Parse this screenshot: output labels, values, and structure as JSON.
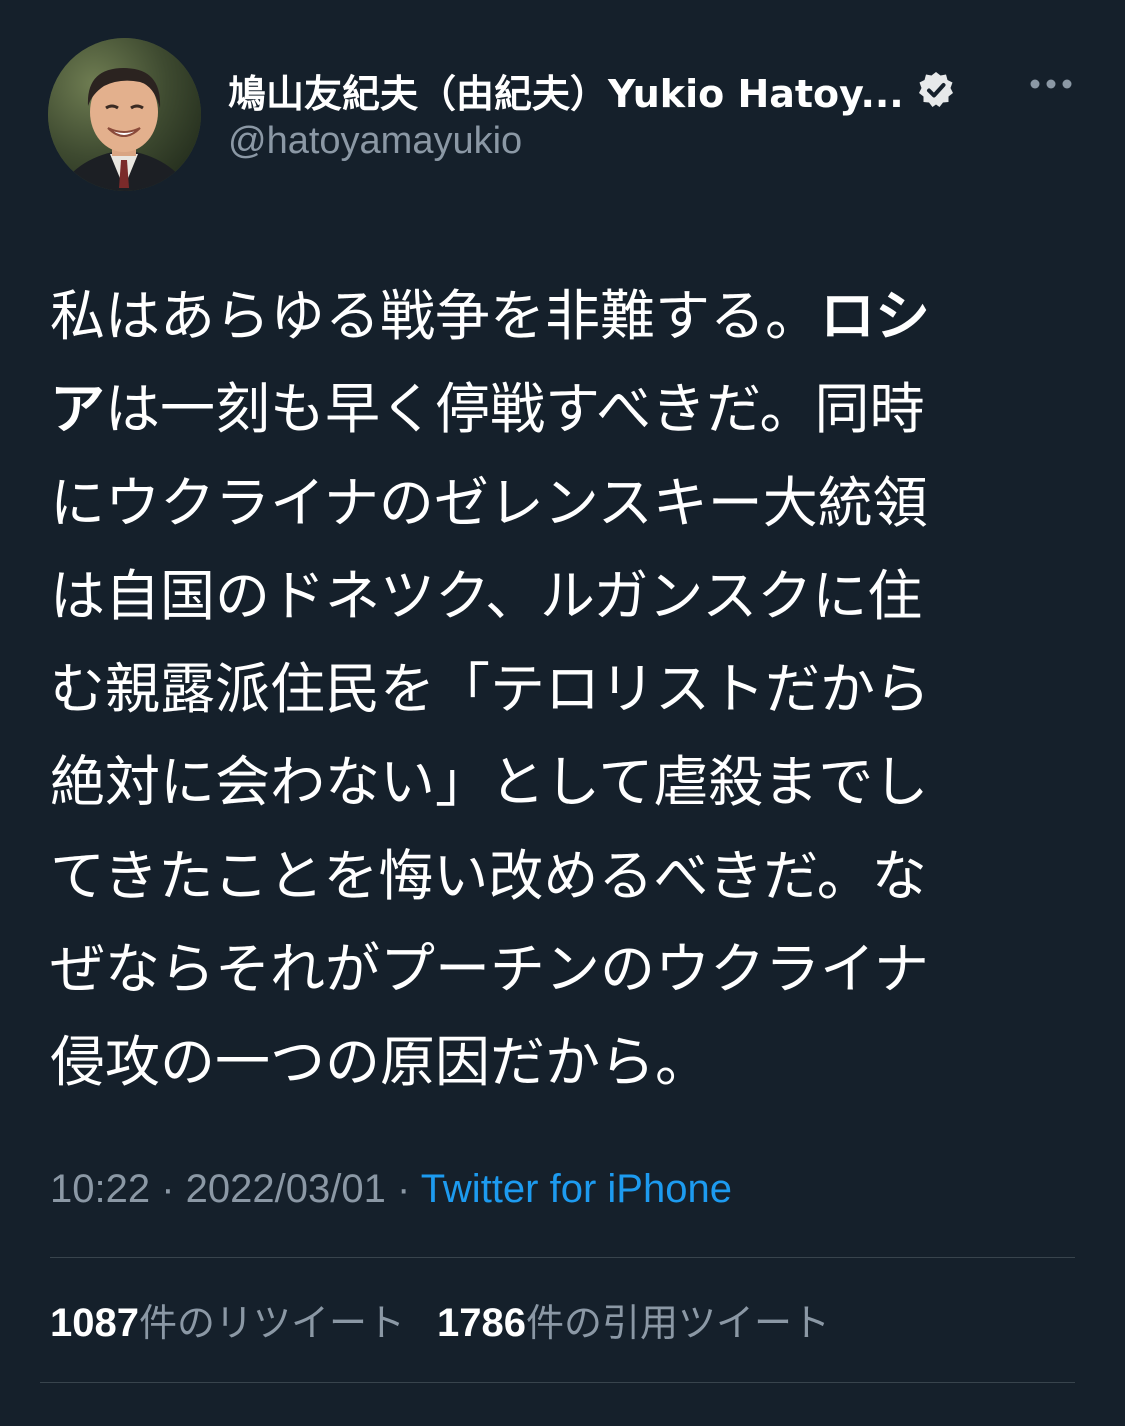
{
  "tweet": {
    "author": {
      "display_name": "鳩山友紀夫（由紀夫）Yukio Hatoy...",
      "handle": "@hatoyamayukio",
      "verified": true
    },
    "text_lines": [
      {
        "plain": "私はあらゆる戦争を非難する。",
        "bold": "ロシ"
      },
      {
        "bold": "ア",
        "plain": "は一刻も早く停戦すべきだ。同時"
      },
      {
        "plain": "にウクライナのゼレンスキー大統領"
      },
      {
        "plain": "は自国のドネツク、ルガンスクに住"
      },
      {
        "plain": "む親露派住民を「テロリストだから"
      },
      {
        "plain": "絶対に会わない」として虐殺までし"
      },
      {
        "plain": "てきたことを悔い改めるべきだ。な"
      },
      {
        "plain": "ぜならそれがプーチンのウクライナ"
      },
      {
        "plain": "侵攻の一つの原因だから。"
      }
    ],
    "meta": {
      "time": "10:22",
      "separator": " · ",
      "date": "2022/03/01",
      "source": "Twitter for iPhone"
    },
    "stats": {
      "retweets_count": "1087",
      "retweets_label": "件のリツイート",
      "quotes_count": "1786",
      "quotes_label": "件の引用ツイート"
    }
  },
  "icons": {
    "verified": "verified-badge-icon",
    "more": "more-horizontal-icon"
  },
  "colors": {
    "background": "#15202b",
    "text_primary": "#ffffff",
    "text_secondary": "#8b98a5",
    "link": "#1d9bf0",
    "divider": "#38444d"
  }
}
